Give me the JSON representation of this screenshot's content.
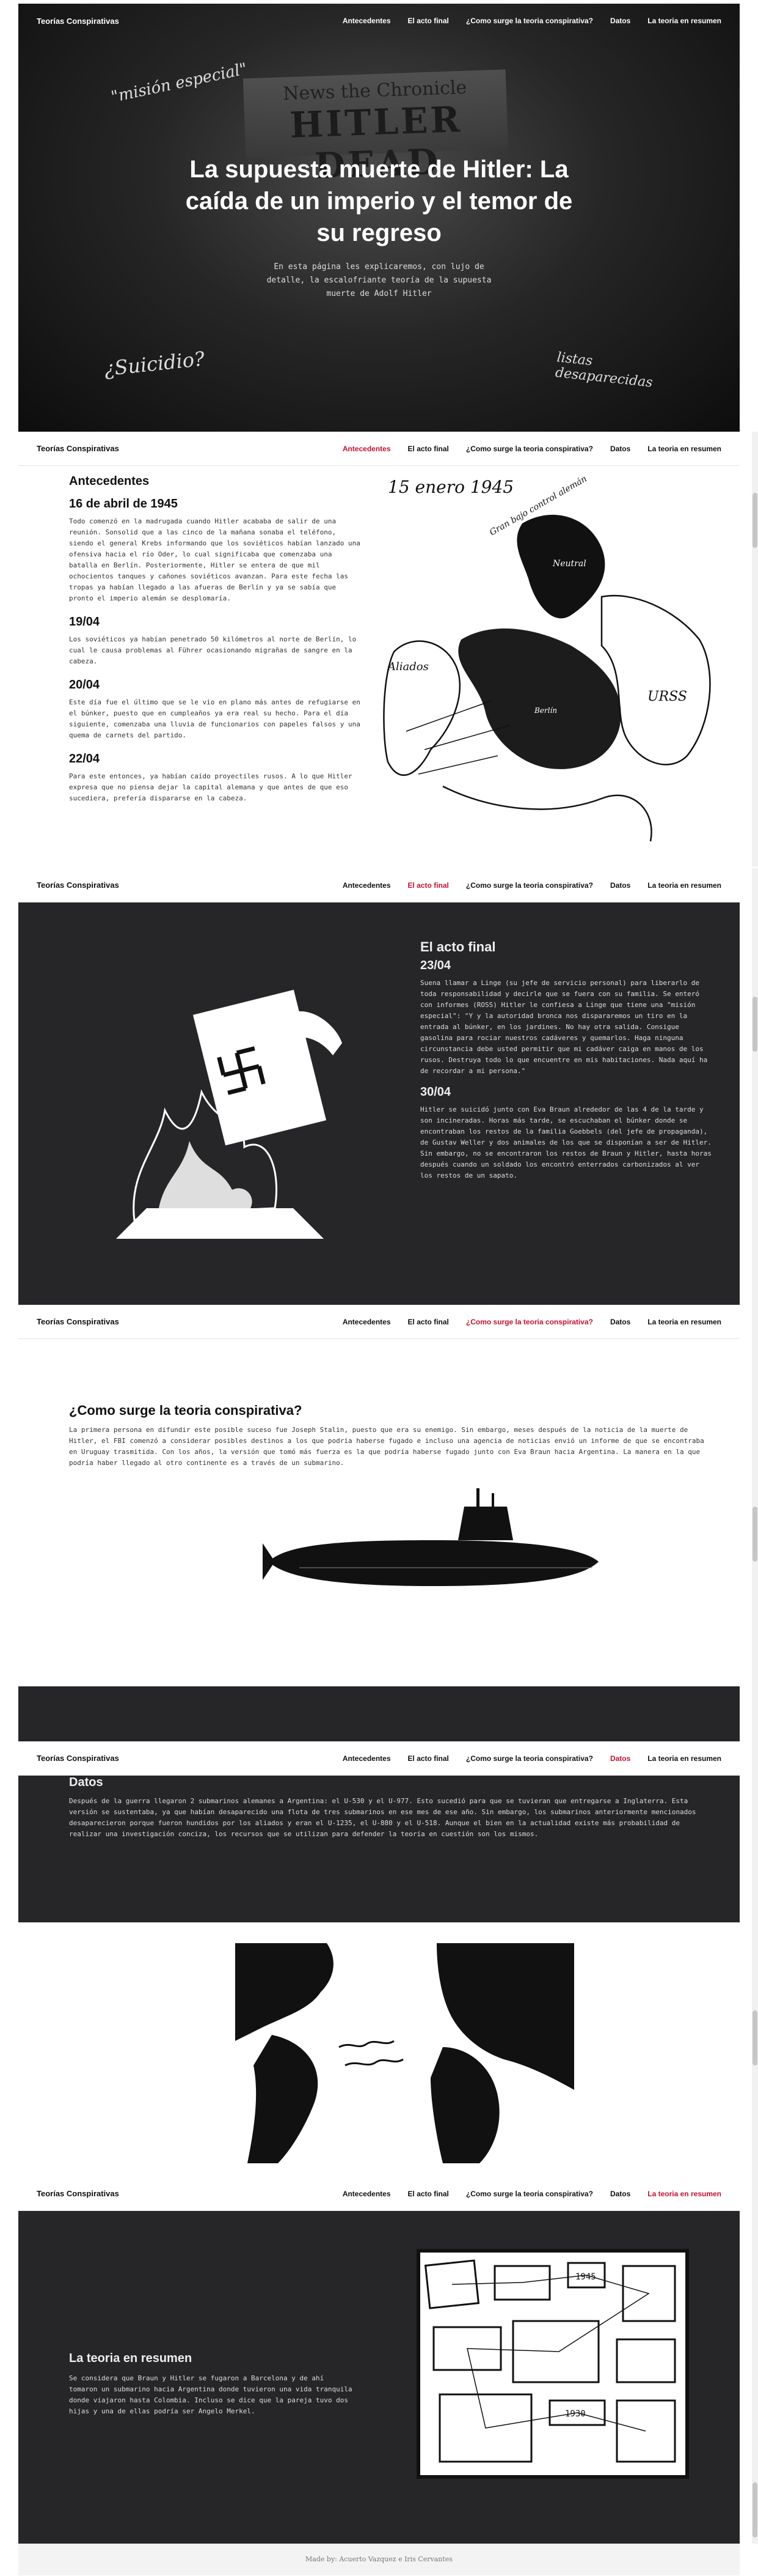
{
  "nav": {
    "brand": "Teorías Conspirativas",
    "links": [
      "Antecedentes",
      "El acto final",
      "¿Como surge la teoria conspirativa?",
      "Datos",
      "La teoria en resumen"
    ]
  },
  "hero": {
    "newspaper_name": "News the Chronicle",
    "newspaper_headline": "HITLER DEAD",
    "handwritten": [
      "\"misión especial\"",
      "¿Suicidio?",
      "listas desaparecidas"
    ],
    "title": "La supuesta muerte de Hitler: La caída de un imperio y el temor de su regreso",
    "subtitle": "En esta página les explicaremos, con lujo de detalle, la escalofriante teoría de la supuesta muerte de Adolf Hitler"
  },
  "antecedentes": {
    "heading": "Antecedentes",
    "entries": [
      {
        "date": "16 de abril de 1945",
        "text": "Todo comenzó en la madrugada cuando Hitler acababa de salir de una reunión. Sonsolid que a las cinco de la mañana sonaba el teléfono, siendo el general Krebs informando que los soviéticos habían lanzado una ofensiva hacia el río Oder, lo cual significaba que comenzaba una batalla en Berlín. Posteriormente, Hitler se entera de que mil ochocientos tanques y cañones soviéticos avanzan. Para este fecha las tropas ya habían llegado a las afueras de Berlín y ya se sabía que pronto el imperio alemán se desplomaría."
      },
      {
        "date": "19/04",
        "text": "Los soviéticos ya habían penetrado 50 kilómetros al norte de Berlín, lo cual le causa problemas al Führer ocasionando migrañas de sangre en la cabeza."
      },
      {
        "date": "20/04",
        "text": "Este día fue el último que se le vio en plano más antes de refugiarse en el búnker, puesto que en cumpleaños ya era real su hecho. Para el día siguiente, comenzaba una lluvia de funcionarios con papeles falsos y una quema de carnets del partido."
      },
      {
        "date": "22/04",
        "text": "Para este entonces, ya habían caído proyectiles rusos. A lo que Hitler expresa que no piensa dejar la capital alemana y que antes de que eso sucediera, prefería dispararse en la cabeza."
      }
    ],
    "map_labels": [
      "15 enero 1945",
      "Gran bajo control alemán",
      "Aliados",
      "URSS",
      "Neutral",
      "Berlín"
    ]
  },
  "acto": {
    "heading": "El acto final",
    "entries": [
      {
        "date": "23/04",
        "text": "Suena llamar a Linge (su jefe de servicio personal) para liberarlo de toda responsabilidad y decirle que se fuera con su familia. Se enteró con informes (ROSS) Hitler le confiesa a Linge que tiene una \"misión especial\": \"Y y la autoridad bronca nos dispararemos un tiro en la entrada al búnker, en los jardines. No hay otra salida. Consigue gasolina para rociar nuestros cadáveres y quemarlos. Haga ninguna circunstancia debe usted permitir que mi cadáver caiga en manos de los rusos. Destruya todo lo que encuentre en mis habitaciones. Nada aquí ha de recordar a mi persona.\""
      },
      {
        "date": "30/04",
        "text": "Hitler se suicidó junto con Eva Braun alrededor de las 4 de la tarde y son incineradas. Horas más tarde, se escuchaban el búnker donde se encontraban los restos de la familia Goebbels (del jefe de propaganda), de Gustav Weller y dos animales de los que se disponían a ser de Hitler. Sin embargo, no se encontraron los restos de Braun y Hitler, hasta horas después cuando un soldado los encontró enterrados carbonizados al ver los restos de un sapato."
      }
    ]
  },
  "conspiracion": {
    "heading": "¿Como surge la teoria conspirativa?",
    "text": "La primera persona en difundir este posible suceso fue Joseph Stalin, puesto que era su enemigo. Sin embargo, meses después de la noticia de la muerte de Hitler, el FBI comenzó a considerar posibles destinos a los que podría haberse fugado e incluso una agencia de noticias envió un informe de que se encontraba en Uruguay trasmitida. Con los años, la versión que tomó más fuerza es la que podría haberse fugado junto con Eva Braun hacia Argentina. La manera en la que podría haber llegado al otro continente es a través de un submarino."
  },
  "datos": {
    "heading": "Datos",
    "text": "Después de la guerra llegaron 2 submarinos alemanes a Argentina: el U-530 y el U-977. Esto sucedió para que se tuvieran que entregarse a Inglaterra. Esta versión se sustentaba, ya que habían desaparecido una flota de tres submarinos en ese mes de ese año. Sin embargo, los submarinos anteriormente mencionados desaparecieron porque fueron hundidos por los aliados y eran el U-1235, el U-880 y el U-518. Aunque el bien en la actualidad existe más probabilidad de realizar una investigación conciza, los recursos que se utilizan para defender la teoría en cuestión son los mismos."
  },
  "resumen": {
    "heading": "La teoria en resumen",
    "text": "Se considera que Braun y Hitler se fugaron a Barcelona y de ahí tomaron un submarino hacia Argentina donde tuvieron una vida tranquila donde viajaron hasta Colombia. Incluso se dice que la pareja tuvo dos hijas y una de ellas podría ser Angelo Merkel.",
    "board_labels": [
      "1945",
      "1930"
    ]
  },
  "footer": {
    "text": "Made by: Acuerto Vazquez e Iris Cervantes"
  }
}
